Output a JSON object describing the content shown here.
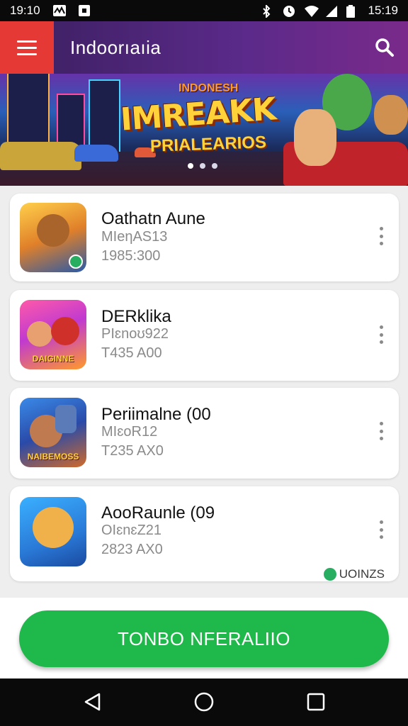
{
  "status_bar": {
    "time_left": "19:10",
    "time_right": "15:19"
  },
  "header": {
    "title": "Indoorıaıia",
    "menu_icon": "hamburger-icon",
    "search_icon": "search-icon"
  },
  "banner": {
    "tagline": "INDONESH",
    "headline": "IMREAKK",
    "subline": "PRIALEARIOS",
    "slides": 3,
    "active_slide": 0
  },
  "games": [
    {
      "name": "Oathatn Aune",
      "line1": "MIeηΑS13",
      "line2": "1985:300",
      "thumb_caption": "",
      "verified": true
    },
    {
      "name": "DERklika",
      "line1": "PIɛnoʊ922",
      "line2": "T435 A00",
      "thumb_caption": "DAIGINNE",
      "verified": false
    },
    {
      "name": "Periimalne (00",
      "line1": "MIɛoR12",
      "line2": "T235 AX0",
      "thumb_caption": "NAIBEMOSS",
      "verified": false
    },
    {
      "name": "AooRaunle (09",
      "line1": "OIɛnɛZ21",
      "line2": "2823 AX0",
      "thumb_caption": "",
      "verified": false
    }
  ],
  "footer_badge": {
    "text": "UOINZS"
  },
  "cta": {
    "label": "TONBO NFERALIIO"
  },
  "nav": {
    "back_icon": "back-triangle-icon",
    "home_icon": "home-circle-icon",
    "recents_icon": "recents-square-icon"
  },
  "colors": {
    "accent_red": "#e53935",
    "cta_green": "#1fb84a",
    "verified_green": "#27ae60"
  }
}
